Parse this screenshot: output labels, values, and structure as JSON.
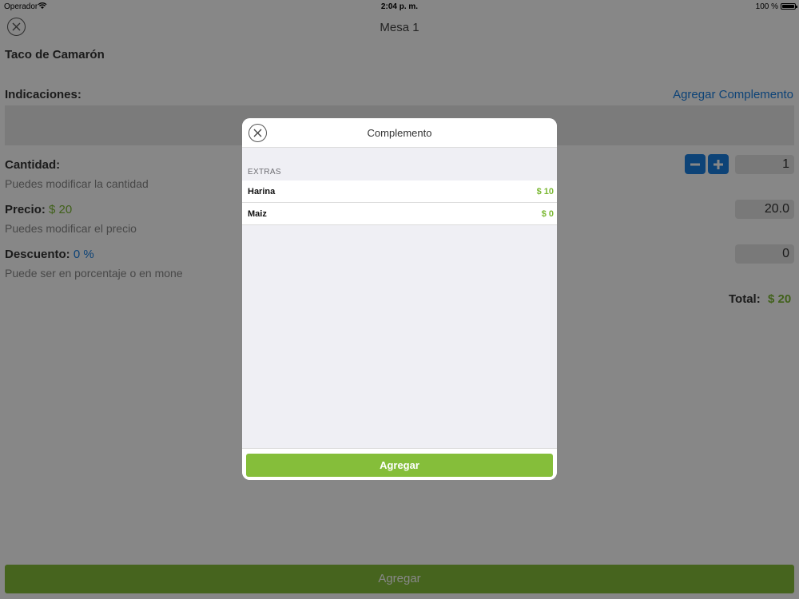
{
  "status_bar": {
    "carrier": "Operador",
    "time": "2:04 p. m.",
    "battery": "100 %"
  },
  "nav": {
    "title": "Mesa 1"
  },
  "product": {
    "name": "Taco de Camarón"
  },
  "notes": {
    "label": "Indicaciones:",
    "add_complement_link": "Agregar Complemento"
  },
  "quantity": {
    "label": "Cantidad:",
    "hint": "Puedes modificar la cantidad",
    "value": "1"
  },
  "price": {
    "label": "Precio:",
    "display": "$ 20",
    "hint": "Puedes modificar el precio",
    "value": "20.0"
  },
  "discount": {
    "label": "Descuento:",
    "display": "0 %",
    "hint": "Puede ser en porcentaje o en mone",
    "value": "0"
  },
  "total": {
    "label": "Total:",
    "value": "$ 20"
  },
  "main_button": {
    "label": "Agregar"
  },
  "modal": {
    "title": "Complemento",
    "section": "EXTRAS",
    "items": [
      {
        "name": "Harina",
        "price": "$ 10"
      },
      {
        "name": "Maiz",
        "price": "$ 0"
      }
    ],
    "add_button": "Agregar"
  },
  "colors": {
    "accent_green": "#85be3a",
    "price_green": "#7bb833",
    "link_blue": "#1a7fe0",
    "overlay": "rgba(0,0,0,0.47)"
  },
  "icons": [
    "wifi-icon",
    "battery-icon",
    "close-icon",
    "minus-icon",
    "plus-icon"
  ]
}
